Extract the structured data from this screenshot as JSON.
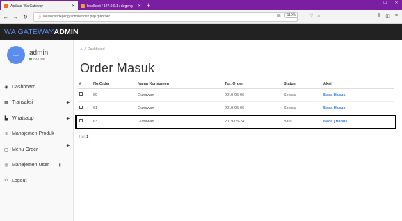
{
  "browser": {
    "tabs": [
      {
        "title": "Aplikasi Wa Gateway",
        "active": true
      },
      {
        "title": "localhost / 127.0.0.1 / degeng",
        "active": false
      }
    ],
    "url": "localhost/degeng/admin/index.php?p=order",
    "zoom": "110%"
  },
  "app": {
    "brand_part1": "WA GATEWAY",
    "brand_part2": "ADMIN"
  },
  "sidebar": {
    "user_name": "admin",
    "user_status": "ONLINE",
    "avatar_text": "user",
    "items": [
      {
        "label": "Dashboard",
        "icon": "dashboard-icon",
        "glyph": "◉"
      },
      {
        "label": "Transaksi",
        "icon": "calendar-icon",
        "glyph": "▦",
        "plus": "+"
      },
      {
        "label": "Whatsapp",
        "icon": "bar-chart-icon",
        "glyph": "▙",
        "plus": "+"
      },
      {
        "label": "Manajemen Produk",
        "icon": "list-icon",
        "glyph": "≡"
      },
      {
        "label": "Menu Order",
        "icon": "file-icon",
        "glyph": "▢",
        "plus": "+"
      },
      {
        "label": "Manajemen User",
        "icon": "user-icon",
        "glyph": "◎",
        "plus": "+"
      },
      {
        "label": "Logout",
        "icon": "power-icon",
        "glyph": "⏻"
      }
    ]
  },
  "main": {
    "breadcrumb": "Dashboard",
    "page_title": "Order Masuk",
    "table": {
      "headers": [
        "#",
        "No.Order",
        "Nama Konsumen",
        "Tgl. Order",
        "Status",
        "Aksi"
      ],
      "rows": [
        {
          "no_order": "60",
          "nama": "Gunawan",
          "tgl": "2019-05-06",
          "status": "Selesai",
          "aksi1": "Baca",
          "aksi2": "Hapus"
        },
        {
          "no_order": "61",
          "nama": "Gunawan",
          "tgl": "2019-05-06",
          "status": "Selesai",
          "aksi1": "Baca",
          "aksi2": "Hapus"
        },
        {
          "no_order": "63",
          "nama": "Gunawan",
          "tgl": "2019-05-24",
          "status": "Baru",
          "aksi1": "Baca",
          "aksi2": "Hapus"
        }
      ]
    },
    "pager_label": "Hal:",
    "pager_page": "1",
    "pager_sep": "|"
  }
}
